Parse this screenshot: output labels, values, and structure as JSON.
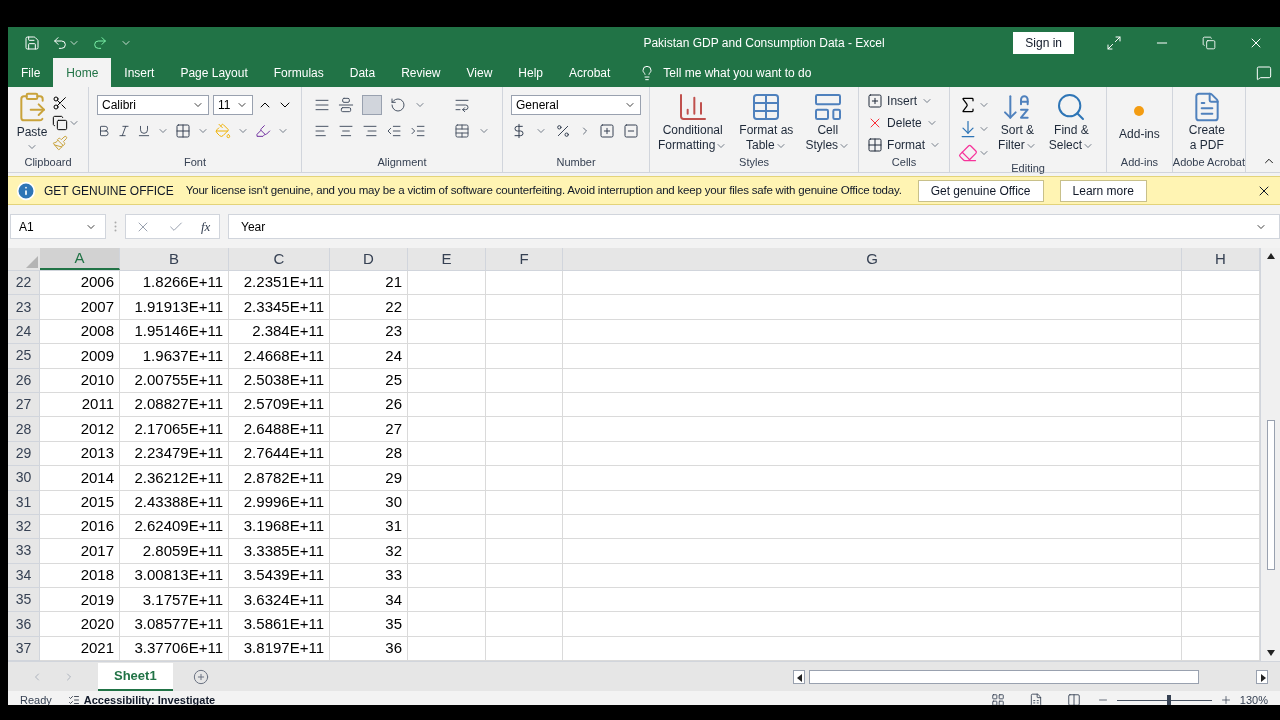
{
  "window": {
    "title": "Pakistan GDP and Consumption Data  -  Excel",
    "sign_in": "Sign in"
  },
  "tabs": [
    {
      "label": "File",
      "selected": false
    },
    {
      "label": "Home",
      "selected": true
    },
    {
      "label": "Insert",
      "selected": false
    },
    {
      "label": "Page Layout",
      "selected": false
    },
    {
      "label": "Formulas",
      "selected": false
    },
    {
      "label": "Data",
      "selected": false
    },
    {
      "label": "Review",
      "selected": false
    },
    {
      "label": "View",
      "selected": false
    },
    {
      "label": "Help",
      "selected": false
    },
    {
      "label": "Acrobat",
      "selected": false
    }
  ],
  "tell_me": "Tell me what you want to do",
  "ribbon": {
    "groups": [
      {
        "kind": "clipboard",
        "label": "Clipboard",
        "paste": "Paste"
      },
      {
        "kind": "font",
        "label": "Font",
        "font_name": "Calibri",
        "font_size": "11"
      },
      {
        "kind": "alignment",
        "label": "Alignment"
      },
      {
        "kind": "number",
        "label": "Number",
        "format": "General"
      },
      {
        "kind": "styles",
        "label": "Styles",
        "buttons": [
          {
            "lines": [
              "Conditional",
              "Formatting"
            ],
            "dropdown": true
          },
          {
            "lines": [
              "Format as",
              "Table"
            ],
            "dropdown": true
          },
          {
            "lines": [
              "Cell",
              "Styles"
            ],
            "dropdown": true
          }
        ]
      },
      {
        "kind": "cells",
        "label": "Cells",
        "buttons": [
          "Insert",
          "Delete",
          "Format"
        ]
      },
      {
        "kind": "editing",
        "label": "Editing",
        "buttons": [
          {
            "lines": [
              "Sort &",
              "Filter"
            ],
            "dropdown": true
          },
          {
            "lines": [
              "Find &",
              "Select"
            ],
            "dropdown": true
          }
        ]
      },
      {
        "kind": "addins",
        "label": "Add-ins",
        "buttons": [
          {
            "lines": [
              "Add-ins"
            ],
            "dropdown": false
          }
        ]
      },
      {
        "kind": "acrobat",
        "label": "Adobe Acrobat",
        "buttons": [
          {
            "lines": [
              "Create",
              "a PDF"
            ],
            "dropdown": false
          }
        ]
      }
    ]
  },
  "banner": {
    "title": "GET GENUINE OFFICE",
    "message": "Your license isn't genuine, and you may be a victim of software counterfeiting. Avoid interruption and keep your files safe with genuine Office today.",
    "buttons": [
      "Get genuine Office",
      "Learn more"
    ]
  },
  "formula_bar": {
    "name_box": "A1",
    "function_label": "fx",
    "value": "Year"
  },
  "columns": [
    {
      "label": "A",
      "selected": true
    },
    {
      "label": "B",
      "selected": false
    },
    {
      "label": "C",
      "selected": false
    },
    {
      "label": "D",
      "selected": false
    },
    {
      "label": "E",
      "selected": false
    },
    {
      "label": "F",
      "selected": false
    },
    {
      "label": "G",
      "selected": false
    },
    {
      "label": "H",
      "selected": false
    }
  ],
  "rows": [
    {
      "number": "22",
      "cells": [
        "2006",
        "1.8266E+11",
        "2.2351E+11",
        "21"
      ]
    },
    {
      "number": "23",
      "cells": [
        "2007",
        "1.91913E+11",
        "2.3345E+11",
        "22"
      ]
    },
    {
      "number": "24",
      "cells": [
        "2008",
        "1.95146E+11",
        "2.384E+11",
        "23"
      ]
    },
    {
      "number": "25",
      "cells": [
        "2009",
        "1.9637E+11",
        "2.4668E+11",
        "24"
      ]
    },
    {
      "number": "26",
      "cells": [
        "2010",
        "2.00755E+11",
        "2.5038E+11",
        "25"
      ]
    },
    {
      "number": "27",
      "cells": [
        "2011",
        "2.08827E+11",
        "2.5709E+11",
        "26"
      ]
    },
    {
      "number": "28",
      "cells": [
        "2012",
        "2.17065E+11",
        "2.6488E+11",
        "27"
      ]
    },
    {
      "number": "29",
      "cells": [
        "2013",
        "2.23479E+11",
        "2.7644E+11",
        "28"
      ]
    },
    {
      "number": "30",
      "cells": [
        "2014",
        "2.36212E+11",
        "2.8782E+11",
        "29"
      ]
    },
    {
      "number": "31",
      "cells": [
        "2015",
        "2.43388E+11",
        "2.9996E+11",
        "30"
      ]
    },
    {
      "number": "32",
      "cells": [
        "2016",
        "2.62409E+11",
        "3.1968E+11",
        "31"
      ]
    },
    {
      "number": "33",
      "cells": [
        "2017",
        "2.8059E+11",
        "3.3385E+11",
        "32"
      ]
    },
    {
      "number": "34",
      "cells": [
        "2018",
        "3.00813E+11",
        "3.5439E+11",
        "33"
      ]
    },
    {
      "number": "35",
      "cells": [
        "2019",
        "3.1757E+11",
        "3.6324E+11",
        "34"
      ]
    },
    {
      "number": "36",
      "cells": [
        "2020",
        "3.08577E+11",
        "3.5861E+11",
        "35"
      ]
    },
    {
      "number": "37",
      "cells": [
        "2021",
        "3.37706E+11",
        "3.8197E+11",
        "36"
      ]
    }
  ],
  "sheets": [
    {
      "label": "Sheet1",
      "selected": true
    }
  ],
  "status": {
    "mode": "Ready",
    "accessibility": "Accessibility: Investigate",
    "zoom": "130%"
  },
  "zoom_slider": {
    "level": 0.55
  }
}
